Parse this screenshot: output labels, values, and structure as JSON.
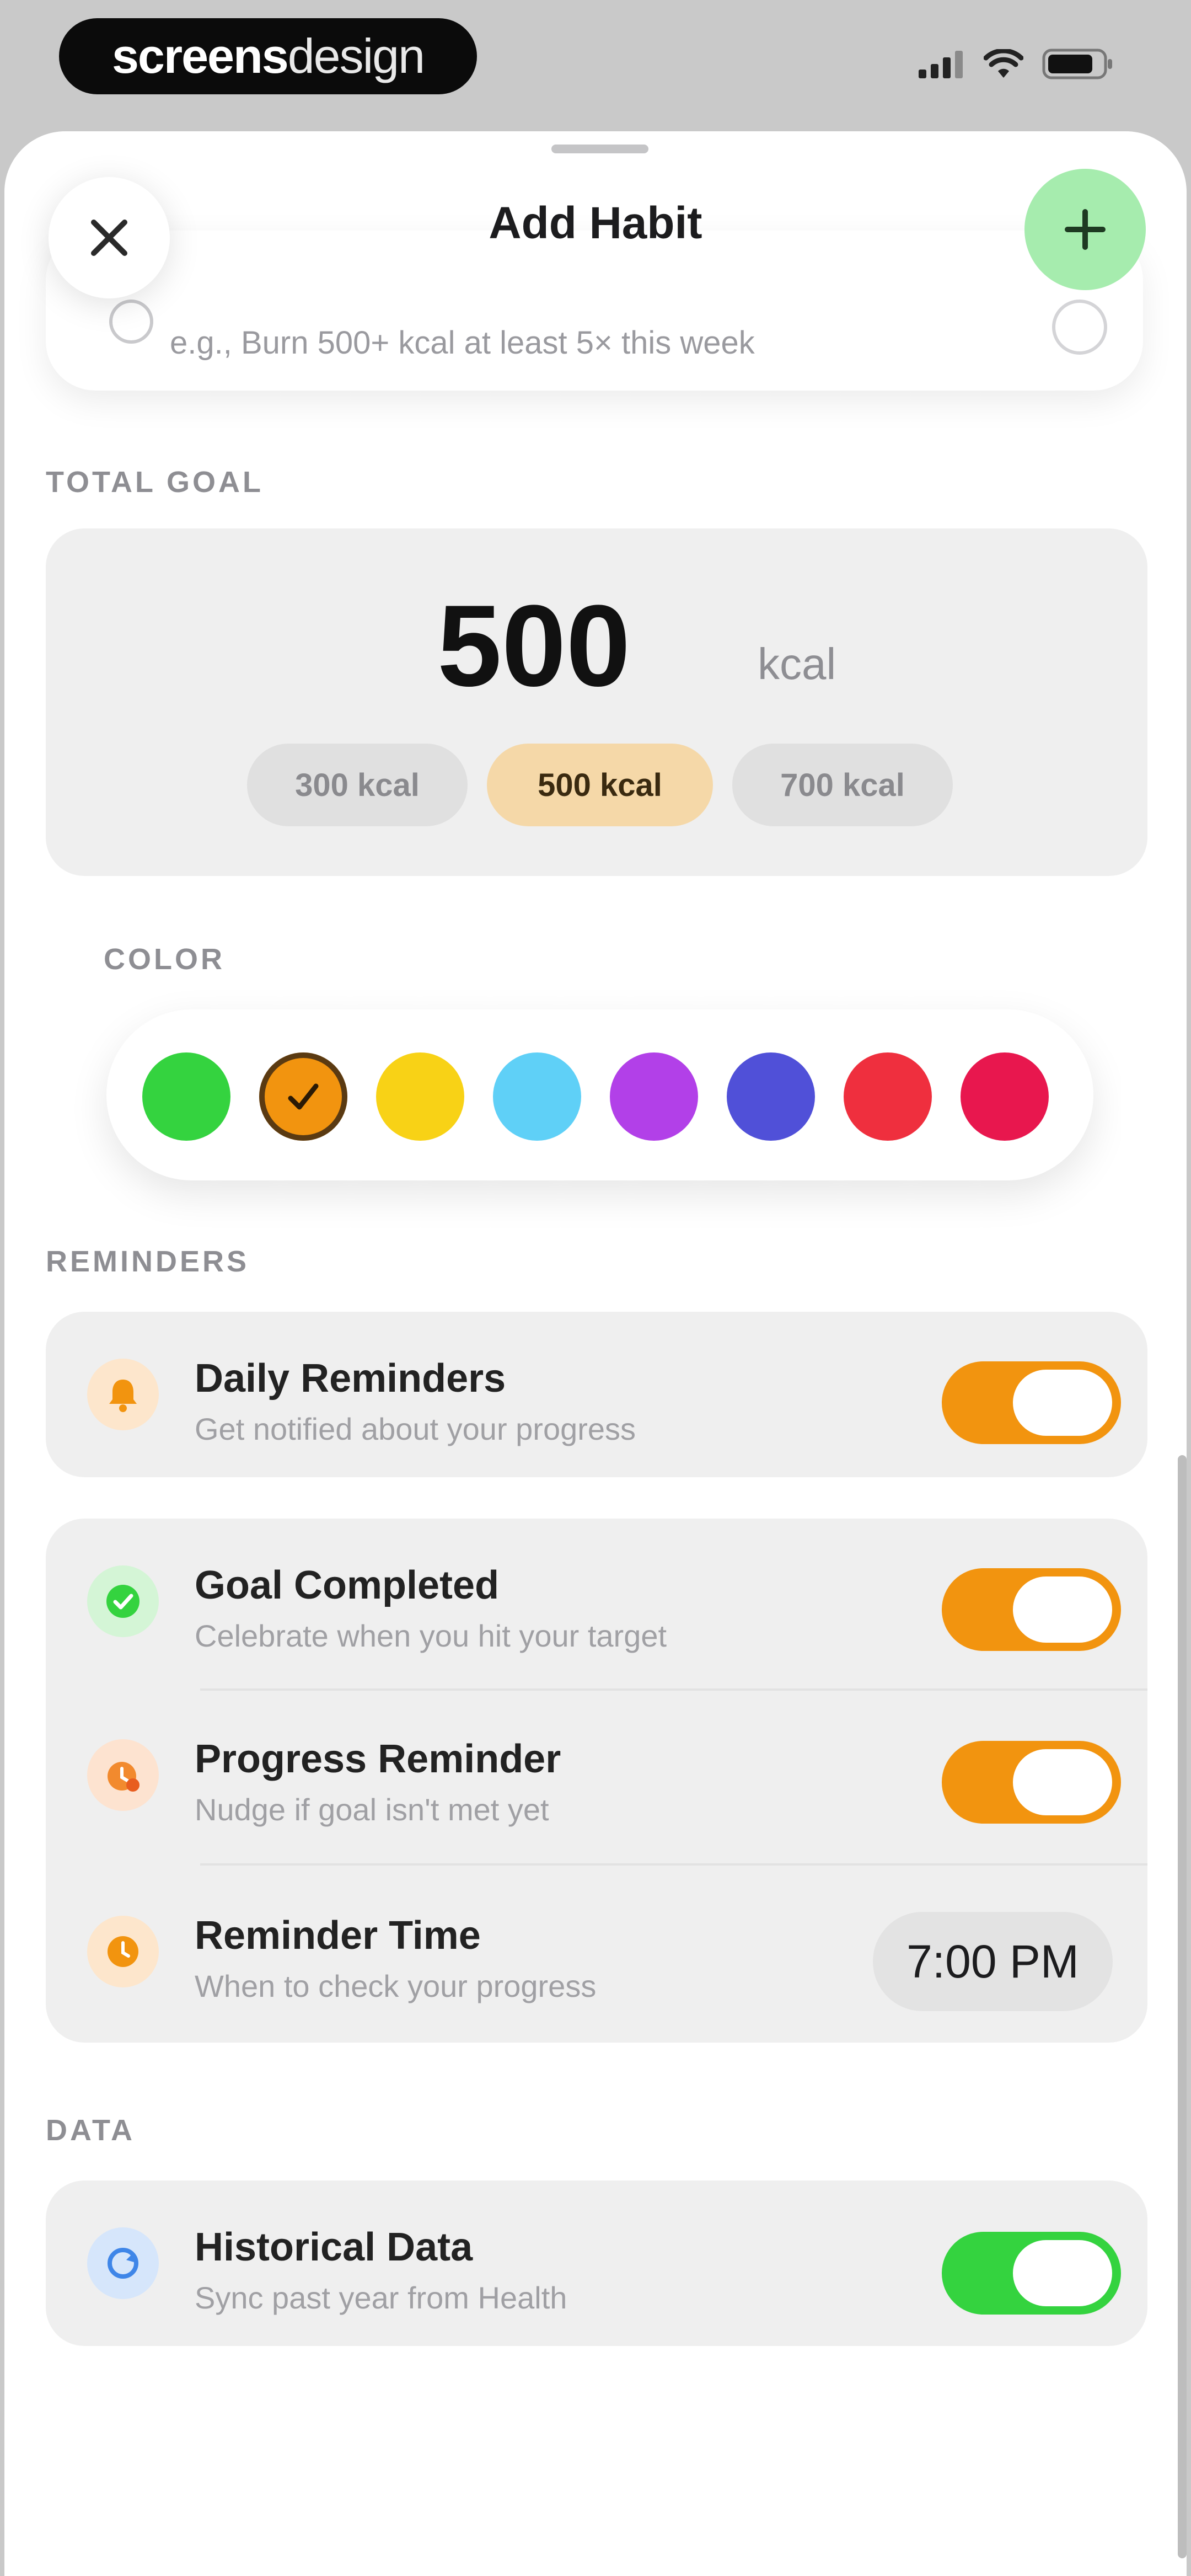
{
  "status_bar": {
    "brand_bold": "screens",
    "brand_light": "design",
    "icons": [
      "cellular-signal-icon",
      "wifi-icon",
      "battery-icon"
    ]
  },
  "header": {
    "title": "Add Habit",
    "close_icon": "close-icon",
    "add_icon": "plus-icon"
  },
  "description": {
    "placeholder": "e.g., Burn 500+ kcal at least 5× this week"
  },
  "total_goal": {
    "label": "TOTAL GOAL",
    "value": "500",
    "unit": "kcal",
    "presets": [
      {
        "label": "300 kcal",
        "selected": false
      },
      {
        "label": "500 kcal",
        "selected": true
      },
      {
        "label": "700 kcal",
        "selected": false
      }
    ]
  },
  "color": {
    "label": "COLOR",
    "swatches": [
      "#34d33f",
      "#f2940f",
      "#f8d216",
      "#5fd0f7",
      "#b240e8",
      "#5050d8",
      "#ef2f3e",
      "#e8174e"
    ],
    "selected_index": 1
  },
  "reminders": {
    "label": "REMINDERS",
    "daily": {
      "title": "Daily Reminders",
      "subtitle": "Get notified about your progress",
      "on": true
    },
    "goal_completed": {
      "title": "Goal Completed",
      "subtitle": "Celebrate when you hit your target",
      "on": true
    },
    "progress": {
      "title": "Progress Reminder",
      "subtitle": "Nudge if goal isn't met yet",
      "on": true
    },
    "time": {
      "title": "Reminder Time",
      "subtitle": "When to check your progress",
      "value": "7:00 PM"
    }
  },
  "data_section": {
    "label": "DATA",
    "historical": {
      "title": "Historical Data",
      "subtitle": "Sync past year from Health",
      "on": true
    }
  },
  "colors": {
    "accent_orange": "#f2940f",
    "accent_green": "#34d33f",
    "add_button_bg": "#a6ecae"
  }
}
